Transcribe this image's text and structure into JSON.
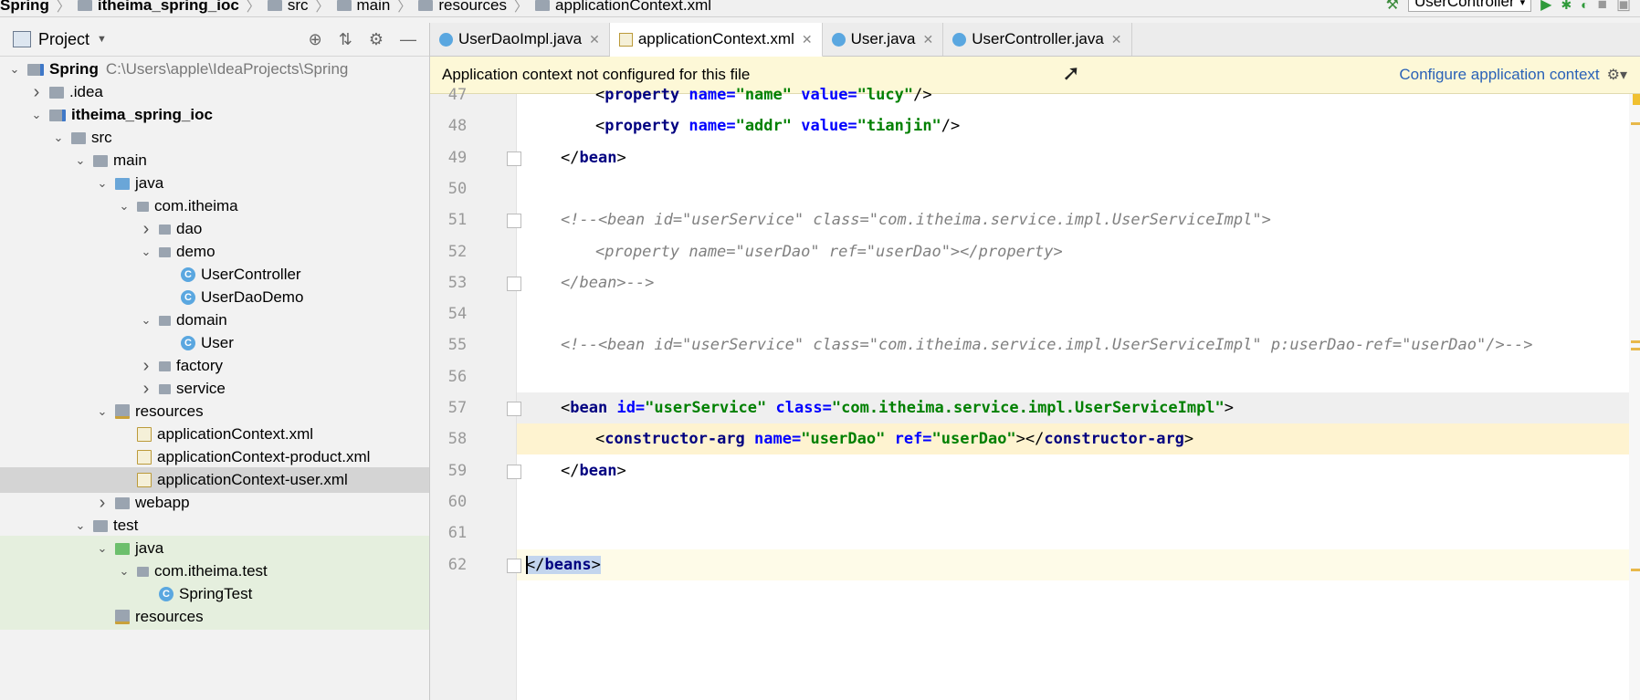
{
  "breadcrumb": [
    "Spring",
    "itheima_spring_ioc",
    "src",
    "main",
    "resources",
    "applicationContext.xml"
  ],
  "run_config": "UserController",
  "project_panel": {
    "title": "Project",
    "tree": [
      {
        "label": "Spring",
        "path": "C:\\Users\\apple\\IdeaProjects\\Spring",
        "depth": 0,
        "arrow": "v",
        "icon": "mod",
        "bold": true
      },
      {
        "label": ".idea",
        "depth": 1,
        "arrow": ">",
        "icon": "fold"
      },
      {
        "label": "itheima_spring_ioc",
        "depth": 1,
        "arrow": "v",
        "icon": "mod",
        "bold": true
      },
      {
        "label": "src",
        "depth": 2,
        "arrow": "v",
        "icon": "fold"
      },
      {
        "label": "main",
        "depth": 3,
        "arrow": "v",
        "icon": "fold"
      },
      {
        "label": "java",
        "depth": 4,
        "arrow": "v",
        "icon": "src"
      },
      {
        "label": "com.itheima",
        "depth": 5,
        "arrow": "v",
        "icon": "pkg"
      },
      {
        "label": "dao",
        "depth": 6,
        "arrow": ">",
        "icon": "pkg"
      },
      {
        "label": "demo",
        "depth": 6,
        "arrow": "v",
        "icon": "pkg"
      },
      {
        "label": "UserController",
        "depth": 7,
        "arrow": "",
        "icon": "cls"
      },
      {
        "label": "UserDaoDemo",
        "depth": 7,
        "arrow": "",
        "icon": "cls"
      },
      {
        "label": "domain",
        "depth": 6,
        "arrow": "v",
        "icon": "pkg"
      },
      {
        "label": "User",
        "depth": 7,
        "arrow": "",
        "icon": "cls"
      },
      {
        "label": "factory",
        "depth": 6,
        "arrow": ">",
        "icon": "pkg"
      },
      {
        "label": "service",
        "depth": 6,
        "arrow": ">",
        "icon": "pkg"
      },
      {
        "label": "resources",
        "depth": 4,
        "arrow": "v",
        "icon": "res"
      },
      {
        "label": "applicationContext.xml",
        "depth": 5,
        "arrow": "",
        "icon": "xml"
      },
      {
        "label": "applicationContext-product.xml",
        "depth": 5,
        "arrow": "",
        "icon": "xml"
      },
      {
        "label": "applicationContext-user.xml",
        "depth": 5,
        "arrow": "",
        "icon": "xml",
        "selected": true
      },
      {
        "label": "webapp",
        "depth": 4,
        "arrow": ">",
        "icon": "fold"
      },
      {
        "label": "test",
        "depth": 3,
        "arrow": "v",
        "icon": "fold"
      },
      {
        "label": "java",
        "depth": 4,
        "arrow": "v",
        "icon": "tst",
        "green": true
      },
      {
        "label": "com.itheima.test",
        "depth": 5,
        "arrow": "v",
        "icon": "pkg",
        "green": true
      },
      {
        "label": "SpringTest",
        "depth": 6,
        "arrow": "",
        "icon": "cls",
        "green": true
      },
      {
        "label": "resources",
        "depth": 4,
        "arrow": "",
        "icon": "res",
        "green": true
      }
    ]
  },
  "tabs": [
    {
      "label": "UserDaoImpl.java",
      "icon": "cls"
    },
    {
      "label": "applicationContext.xml",
      "icon": "xml",
      "active": true
    },
    {
      "label": "User.java",
      "icon": "cls"
    },
    {
      "label": "UserController.java",
      "icon": "cls"
    }
  ],
  "banner": {
    "message": "Application context not configured for this file",
    "action": "Configure application context"
  },
  "code_lines": [
    {
      "n": "47",
      "indent": 2,
      "html": "<span class='punct'>&lt;</span><span class='tagc'>property</span> <span class='attr'>name=</span><span class='val'>\"name\"</span> <span class='attr'>value=</span><span class='val'>\"lucy\"</span><span class='punct'>/&gt;</span>"
    },
    {
      "n": "48",
      "indent": 2,
      "html": "<span class='punct'>&lt;</span><span class='tagc'>property</span> <span class='attr'>name=</span><span class='val'>\"addr\"</span> <span class='attr'>value=</span><span class='val'>\"tianjin\"</span><span class='punct'>/&gt;</span>"
    },
    {
      "n": "49",
      "indent": 1,
      "fold": true,
      "html": "<span class='punct'>&lt;/</span><span class='tagc'>bean</span><span class='punct'>&gt;</span>"
    },
    {
      "n": "50",
      "indent": 0,
      "html": ""
    },
    {
      "n": "51",
      "indent": 1,
      "fold": true,
      "html": "<span class='cmt'>&lt;!--&lt;bean id=\"userService\" class=\"com.itheima.service.impl.UserServiceImpl\"&gt;</span>"
    },
    {
      "n": "52",
      "indent": 2,
      "html": "<span class='cmt'>&lt;property name=\"userDao\" ref=\"userDao\"&gt;&lt;/property&gt;</span>"
    },
    {
      "n": "53",
      "indent": 1,
      "fold": true,
      "html": "<span class='cmt'>&lt;/bean&gt;--&gt;</span>"
    },
    {
      "n": "54",
      "indent": 0,
      "html": ""
    },
    {
      "n": "55",
      "indent": 1,
      "html": "<span class='cmt'>&lt;!--&lt;bean id=\"userService\" class=\"com.itheima.service.impl.UserServiceImpl\" p:userDao-ref=\"userDao\"/&gt;--&gt;</span>"
    },
    {
      "n": "56",
      "indent": 0,
      "html": ""
    },
    {
      "n": "57",
      "indent": 1,
      "fold": true,
      "hl": "hl57",
      "html": "<span class='punct'>&lt;</span><span class='tagc'>bean</span> <span class='attr'>id=</span><span class='val'>\"userService\"</span> <span class='attr'>class=</span><span class='val'>\"com.itheima.service.impl.UserServiceImpl\"</span><span class='punct'>&gt;</span>"
    },
    {
      "n": "58",
      "indent": 2,
      "hl": "hl58",
      "html": "<span class='punct'>&lt;</span><span class='tagc'>constructor-arg</span> <span class='attr'>name=</span><span class='val'>\"userDao\"</span> <span class='attr'>ref=</span><span class='val'>\"userDao\"</span><span class='punct'>&gt;&lt;/</span><span class='tagc'>constructor-arg</span><span class='punct'>&gt;</span>"
    },
    {
      "n": "59",
      "indent": 1,
      "fold": true,
      "html": "<span class='punct'>&lt;/</span><span class='tagc'>bean</span><span class='punct'>&gt;</span>"
    },
    {
      "n": "60",
      "indent": 0,
      "html": ""
    },
    {
      "n": "61",
      "indent": 0,
      "html": ""
    },
    {
      "n": "62",
      "indent": 0,
      "fold": true,
      "cur": true,
      "html": "<span class='selbeans'><span class='punct'>&lt;/</span><span class='tagc'>beans</span><span class='punct'>&gt;</span></span>"
    }
  ]
}
